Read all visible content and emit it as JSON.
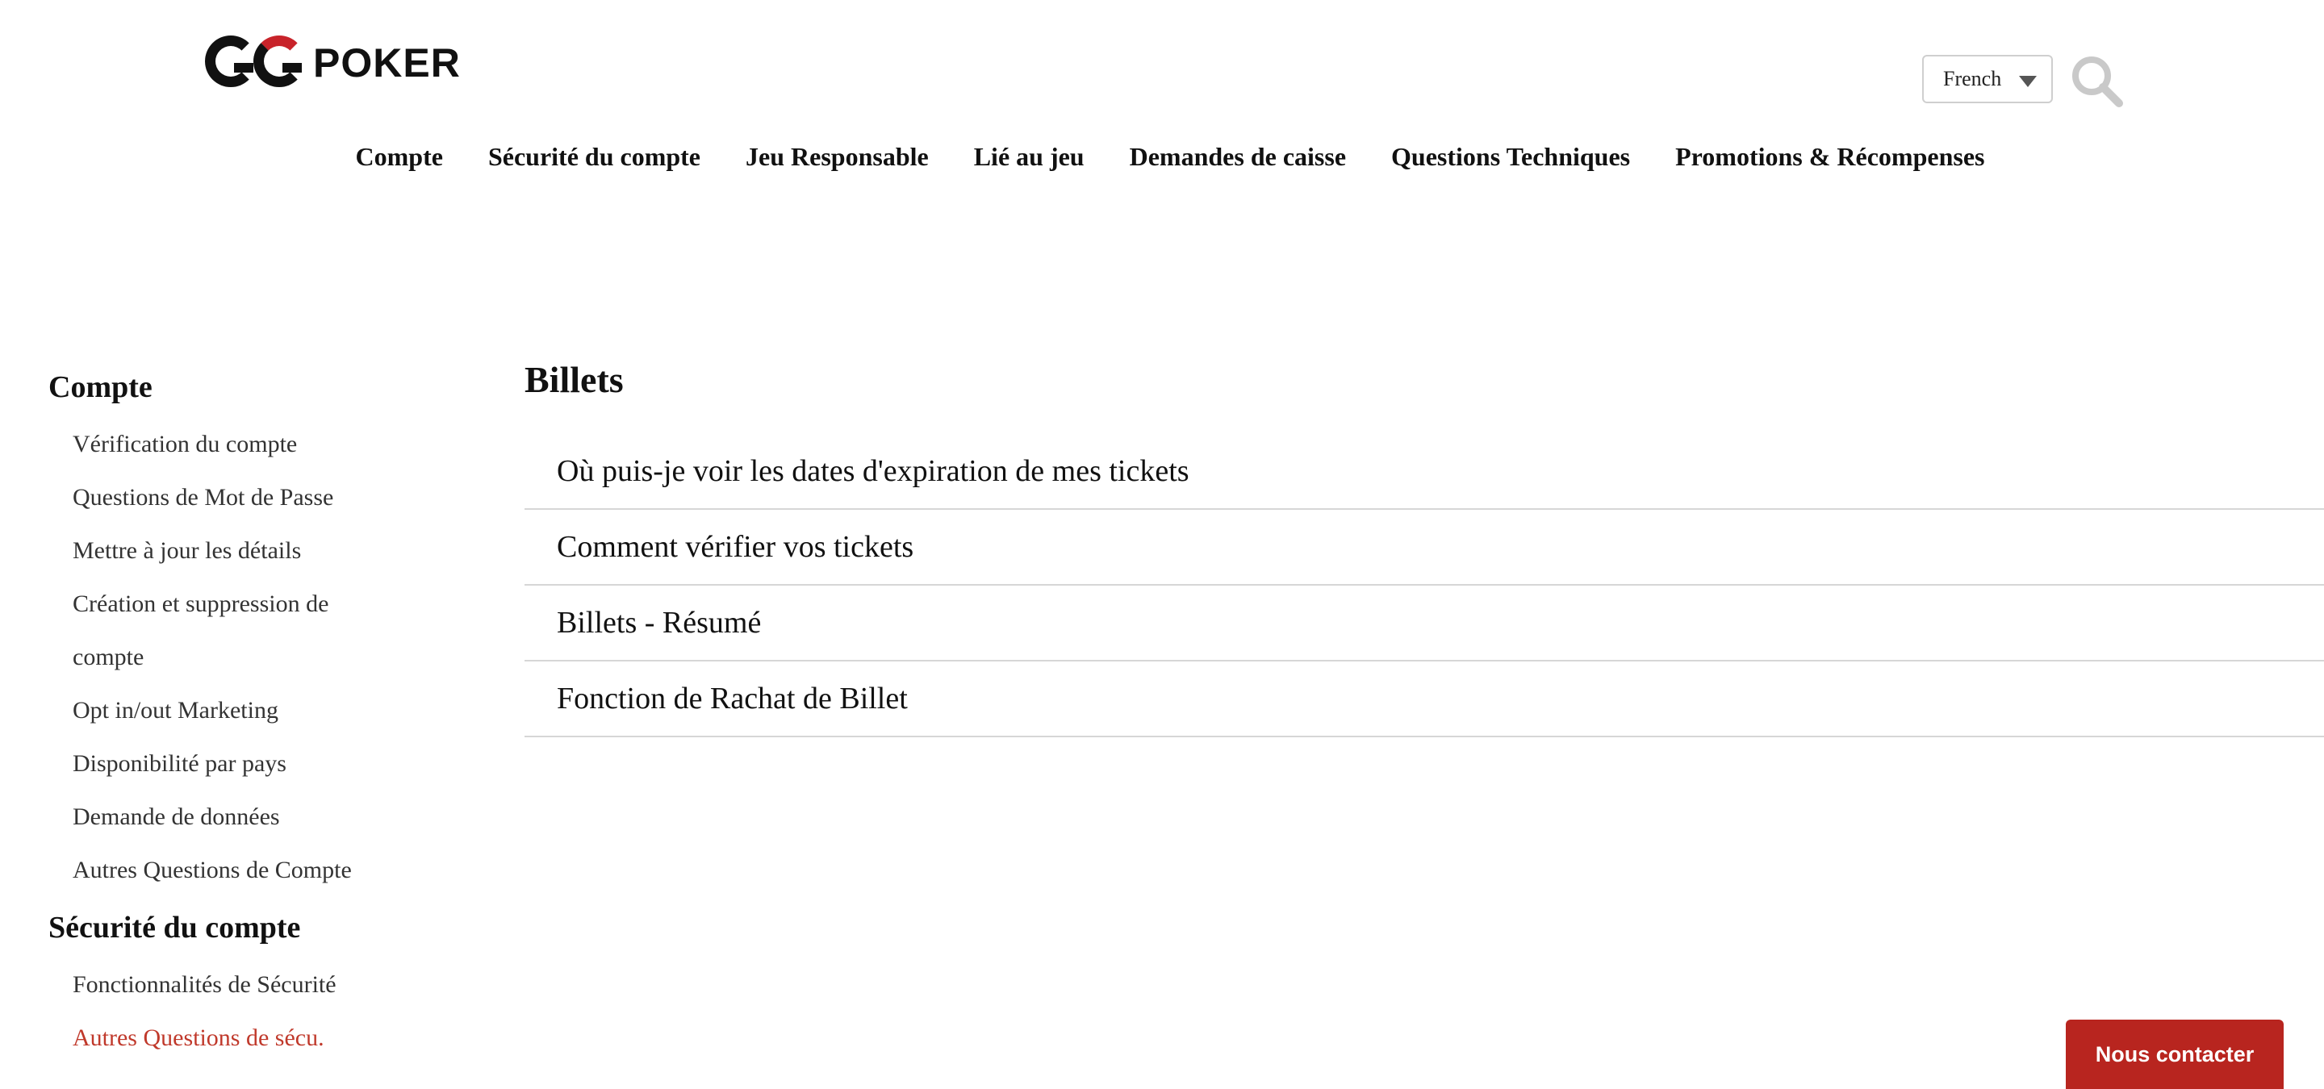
{
  "brand": {
    "logo_text": "GGPOKER"
  },
  "header": {
    "language": {
      "selected": "French"
    },
    "search_icon": "search-icon"
  },
  "top_nav": {
    "items": [
      "Compte",
      "Sécurité du compte",
      "Jeu Responsable",
      "Lié au jeu",
      "Demandes de caisse",
      "Questions Techniques",
      "Promotions & Récompenses"
    ]
  },
  "sidebar": {
    "sections": [
      {
        "title": "Compte",
        "items": [
          "Vérification du compte",
          "Questions de Mot de Passe",
          "Mettre à jour les détails",
          "Création et suppression de compte",
          "Opt in/out Marketing",
          "Disponibilité par pays",
          "Demande de données",
          "Autres Questions de Compte"
        ]
      },
      {
        "title": "Sécurité du compte",
        "items": [
          "Fonctionnalités de Sécurité",
          "Autres Questions de sécu."
        ]
      }
    ]
  },
  "main": {
    "title": "Billets",
    "articles": [
      "Où puis-je voir les dates d'expiration de mes tickets",
      "Comment vérifier vos tickets",
      "Billets - Résumé",
      "Fonction de Rachat de Billet"
    ]
  },
  "contact": {
    "label": "Nous contacter"
  },
  "colors": {
    "accent": "#b8251f",
    "active_link": "#c0392b",
    "logo_red": "#c8232a"
  }
}
